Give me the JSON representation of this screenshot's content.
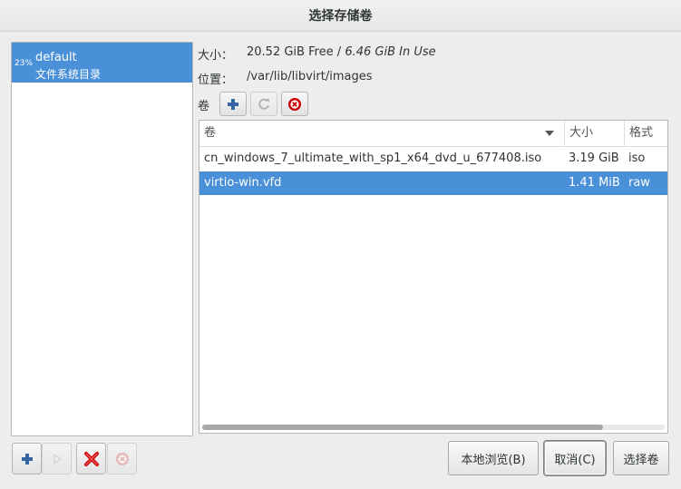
{
  "window": {
    "title": "选择存储卷"
  },
  "pools": [
    {
      "usage": "23%",
      "name": "default",
      "type": "文件系统目录",
      "selected": true
    }
  ],
  "info": {
    "size_label": "大小：",
    "size_free": "20.52 GiB Free / ",
    "size_inuse": "6.46 GiB In Use",
    "location_label": "位置：",
    "location_value": "/var/lib/libvirt/images"
  },
  "volumes_label": "卷",
  "table": {
    "headers": [
      "卷",
      "大小",
      "格式"
    ],
    "rows": [
      {
        "name": "cn_windows_7_ultimate_with_sp1_x64_dvd_u_677408.iso",
        "size": "3.19 GiB",
        "format": "iso",
        "selected": false
      },
      {
        "name": "virtio-win.vfd",
        "size": "1.41 MiB",
        "format": "raw",
        "selected": true
      }
    ]
  },
  "buttons": {
    "browse": "本地浏览(B)",
    "cancel": "取消(C)",
    "choose": "选择卷"
  },
  "colors": {
    "selection": "#4a90d9",
    "add": "#3465a4",
    "delete": "#cc0000"
  }
}
